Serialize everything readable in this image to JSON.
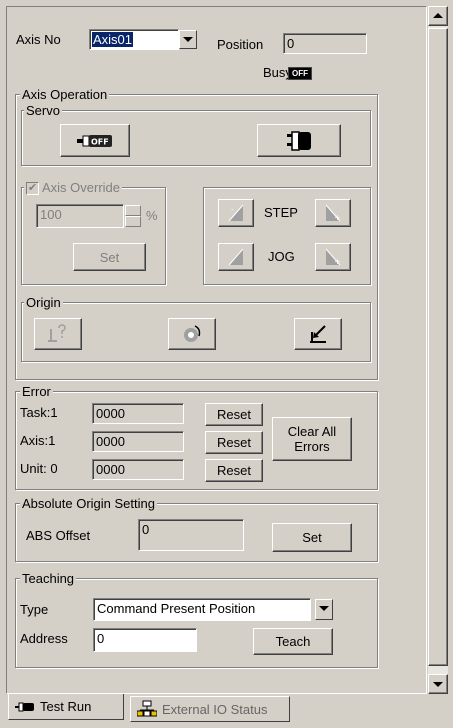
{
  "header": {
    "axis_no_label": "Axis No",
    "axis_no_value": "Axis01",
    "position_label": "Position",
    "position_value": "0",
    "busy_label": "Busy",
    "busy_badge": "OFF"
  },
  "axis_operation": {
    "title": "Axis Operation",
    "servo": {
      "title": "Servo",
      "off_badge": "OFF"
    },
    "override": {
      "title": "Axis Override",
      "checked": true,
      "value": "100",
      "unit": "%",
      "set_label": "Set"
    },
    "step_label": "STEP",
    "jog_label": "JOG",
    "origin": {
      "title": "Origin"
    }
  },
  "error": {
    "title": "Error",
    "rows": [
      {
        "label": "Task:1",
        "value": "0000",
        "reset_label": "Reset"
      },
      {
        "label": "Axis:1",
        "value": "0000",
        "reset_label": "Reset"
      },
      {
        "label": "Unit: 0",
        "value": "0000",
        "reset_label": "Reset"
      }
    ],
    "clear_all_label": "Clear All Errors"
  },
  "abs_origin": {
    "title": "Absolute Origin Setting",
    "offset_label": "ABS Offset",
    "offset_value": "0",
    "set_label": "Set"
  },
  "teaching": {
    "title": "Teaching",
    "type_label": "Type",
    "type_value": "Command Present Position",
    "address_label": "Address",
    "address_value": "0",
    "teach_label": "Teach"
  },
  "tabs": [
    {
      "label": "Test Run",
      "icon": "servo-plug-icon",
      "active": true
    },
    {
      "label": "External IO Status",
      "icon": "network-io-icon",
      "active": false
    }
  ],
  "colors": {
    "face": "#d4d0c8",
    "selection": "#0a246a",
    "disabled_text": "#808080"
  }
}
